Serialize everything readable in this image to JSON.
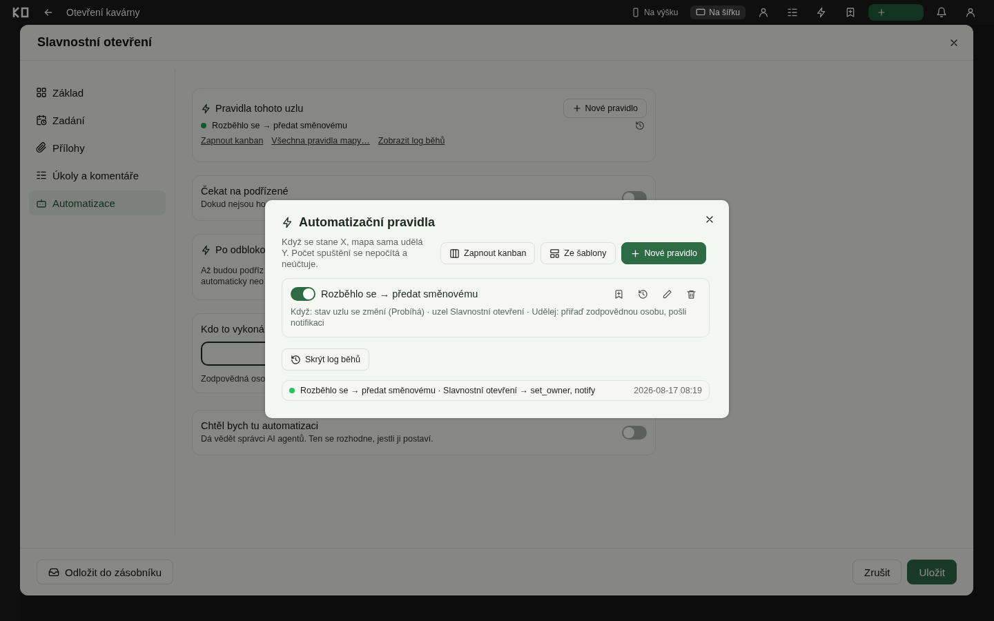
{
  "app_bar": {
    "title": "Otevření kavárny",
    "view_buttons": [
      {
        "label": "Na výšku",
        "selected": false
      },
      {
        "label": "Na šířku",
        "selected": true
      }
    ]
  },
  "dialog": {
    "title": "Slavnostní otevření",
    "nav": [
      {
        "label": "Základ",
        "selected": false
      },
      {
        "label": "Zadání",
        "selected": false
      },
      {
        "label": "Přílohy",
        "selected": false
      },
      {
        "label": "Úkoly a komentáře",
        "selected": false
      },
      {
        "label": "Automatizace",
        "selected": true
      }
    ],
    "cards": [
      {
        "kind": "rules",
        "title": "Pravidla tohoto uzlu",
        "button": "Nové pravidlo",
        "rules": [
          {
            "name": "Rozběhlo se → předat směnovému",
            "active": true
          }
        ],
        "links": [
          "Zapnout kanban",
          "Všechna pravidla mapy…",
          "Zobrazit log běhů"
        ]
      },
      {
        "kind": "toggle",
        "title": "Čekat na podřízené",
        "text": "Dokud nejsou ho",
        "on": false
      },
      {
        "kind": "info",
        "title": "Po odbloko",
        "lines": [
          "Až budou podříz",
          "automaticky neo"
        ]
      },
      {
        "kind": "field",
        "title": "Kdo to vykoná",
        "hint": "Zodpovědná oso"
      },
      {
        "kind": "toggle",
        "title": "Chtěl bych tu automatizaci",
        "text": "Dá vědět správci AI agentů. Ten se rozhodne, jestli ji postaví.",
        "on": false
      }
    ],
    "footer": {
      "defer_button": "Odložit do zásobníku",
      "cancel_button": "Zrušit",
      "save_button": "Uložit"
    }
  },
  "modal": {
    "title": "Automatizační pravidla",
    "description": "Když se stane X, mapa sama udělá Y. Počet spuštění se nepočítá a neúčtuje.",
    "buttons": [
      {
        "label": "Zapnout kanban",
        "kind": "outline"
      },
      {
        "label": "Ze šablony",
        "kind": "outline"
      },
      {
        "label": "Nové pravidlo",
        "kind": "primary"
      }
    ],
    "rules": [
      {
        "name": "Rozběhlo se → předat směnovému",
        "on": true,
        "description": "Když: stav uzlu se změní (Probíhá) · uzel Slavnostní otevření · Udělej: přiřaď zodpovědnou osobu, pošli notifikaci"
      }
    ],
    "log_button": "Skrýt log běhů",
    "log": [
      {
        "text": "Rozběhlo se → předat směnovému · Slavnostní otevření → set_owner, notify",
        "time": "2026-08-17 08:19",
        "color": "#22c55e"
      }
    ]
  }
}
